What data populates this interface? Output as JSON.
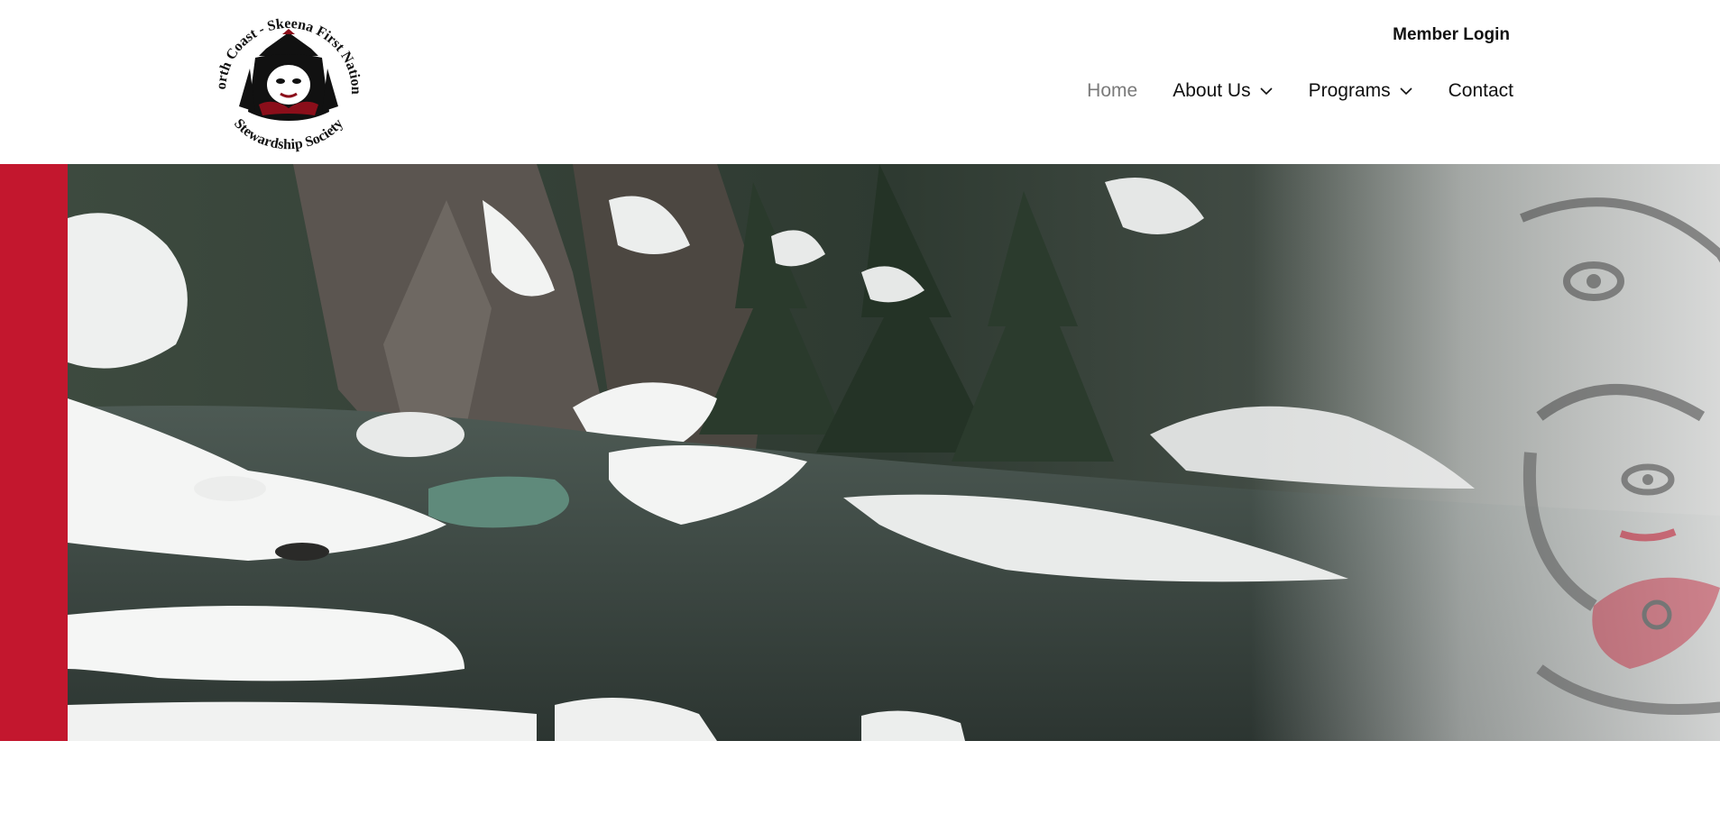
{
  "brand": {
    "logo_text_top": "North Coast - Skeena First Nations",
    "logo_text_bottom": "Stewardship Society",
    "colors": {
      "red": "#c3172e",
      "text": "#111111",
      "muted": "#7a7a7a"
    }
  },
  "header": {
    "member_login": "Member Login",
    "nav": [
      {
        "label": "Home",
        "active": true,
        "dropdown": false
      },
      {
        "label": "About Us",
        "active": false,
        "dropdown": true,
        "icon": "chevron-down-icon"
      },
      {
        "label": "Programs",
        "active": false,
        "dropdown": true,
        "icon": "chevron-down-icon"
      },
      {
        "label": "Contact",
        "active": false,
        "dropdown": false
      }
    ]
  },
  "hero": {
    "image": "snowy-river-canyon-photo",
    "accent": "formline-crest-art"
  }
}
